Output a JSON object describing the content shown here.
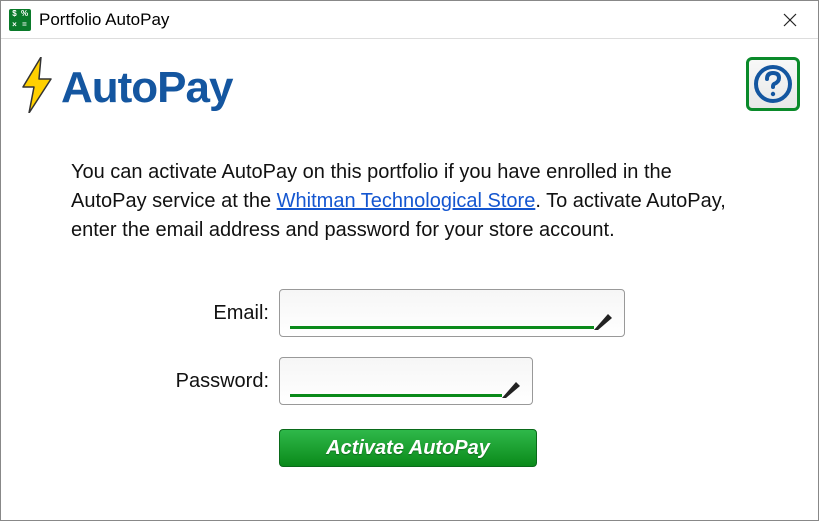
{
  "window": {
    "title": "Portfolio AutoPay"
  },
  "header": {
    "logo_text": "AutoPay"
  },
  "body": {
    "text_before_link": "You can activate AutoPay on this portfolio if you have enrolled in the AutoPay service at the ",
    "link_text": "Whitman Technological Store",
    "text_after_link": ". To activate AutoPay, enter the email address and password for your store account."
  },
  "form": {
    "email_label": "Email:",
    "email_value": "",
    "password_label": "Password:",
    "password_value": "",
    "activate_button": "Activate AutoPay"
  }
}
